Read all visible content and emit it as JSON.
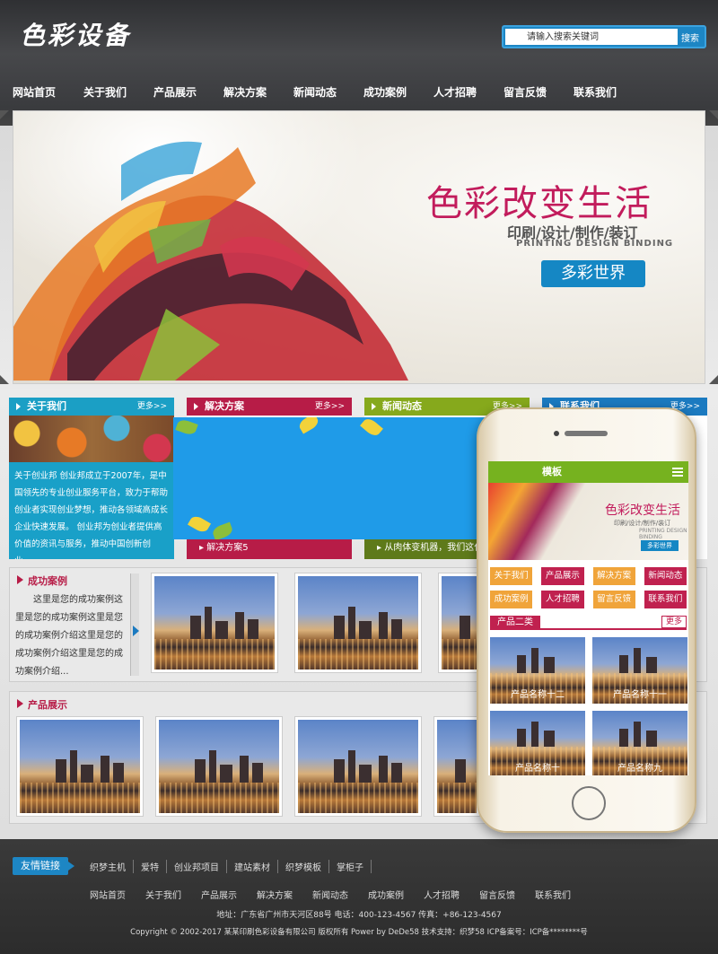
{
  "header": {
    "logo": "色彩设备",
    "search_placeholder": "请输入搜索关键词",
    "search_button": "搜索"
  },
  "nav": [
    "网站首页",
    "关于我们",
    "产品展示",
    "解决方案",
    "新闻动态",
    "成功案例",
    "人才招聘",
    "留言反馈",
    "联系我们"
  ],
  "banner": {
    "title": "色彩改变生活",
    "subtitle": "印刷/设计/制作/装订",
    "english": "PRINTING DESIGN BINDING",
    "button": "多彩世界"
  },
  "boxes": {
    "about": {
      "title": "关于我们",
      "more": "更多>>",
      "text": "关于创业邦 创业邦成立于2007年，是中国领先的专业创业服务平台，致力于帮助创业者实现创业梦想，推动各领域高成长企业快速发展。 创业邦为创业者提供高价值的资讯与服务，推动中国创新创业。.."
    },
    "solve": {
      "title": "解决方案",
      "more": "更多>>",
      "item": "解决方案5"
    },
    "news": {
      "title": "新闻动态",
      "more": "更多>>",
      "item": "从肉体变机器，我们这代"
    },
    "contact": {
      "title": "联系我们",
      "more": "更多>>"
    }
  },
  "cases": {
    "title": "成功案例",
    "text": "这里是您的成功案例这里是您的成功案例这里是您的成功案例介绍这里是您的成功案例介绍这里是您的成功案例介绍..."
  },
  "products": {
    "title": "产品展示"
  },
  "mobile": {
    "top_title": "模板",
    "banner_title": "色彩改变生活",
    "banner_sub": "印刷/设计/制作/装订",
    "banner_en": "PRINTING DESIGN BINDING",
    "banner_btn": "多彩世界",
    "menu": [
      "关于我们",
      "产品展示",
      "解决方案",
      "新闻动态",
      "成功案例",
      "人才招聘",
      "留言反馈",
      "联系我们"
    ],
    "menu_colors": [
      "#f0a43a",
      "#c0214f",
      "#f0a43a",
      "#c0214f",
      "#f0a43a",
      "#c0214f",
      "#f0a43a",
      "#c0214f"
    ],
    "section": "产品二类",
    "section_more": "更多",
    "products": [
      "产品名称十二",
      "产品名称十一",
      "产品名称十",
      "产品名称九"
    ]
  },
  "footer": {
    "links_label": "友情链接",
    "links": [
      "织梦主机",
      "爱特",
      "创业邦项目",
      "建站素材",
      "织梦模板",
      "掌柜子"
    ],
    "nav": [
      "网站首页",
      "关于我们",
      "产品展示",
      "解决方案",
      "新闻动态",
      "成功案例",
      "人才招聘",
      "留言反馈",
      "联系我们"
    ],
    "address": "地址：广东省广州市天河区88号 电话：400-123-4567 传真：+86-123-4567",
    "copyright": "Copyright © 2002-2017 某某印刷色彩设备有限公司 版权所有 Power by DeDe58 技术支持：织梦58 ICP备案号：ICP备********号"
  }
}
